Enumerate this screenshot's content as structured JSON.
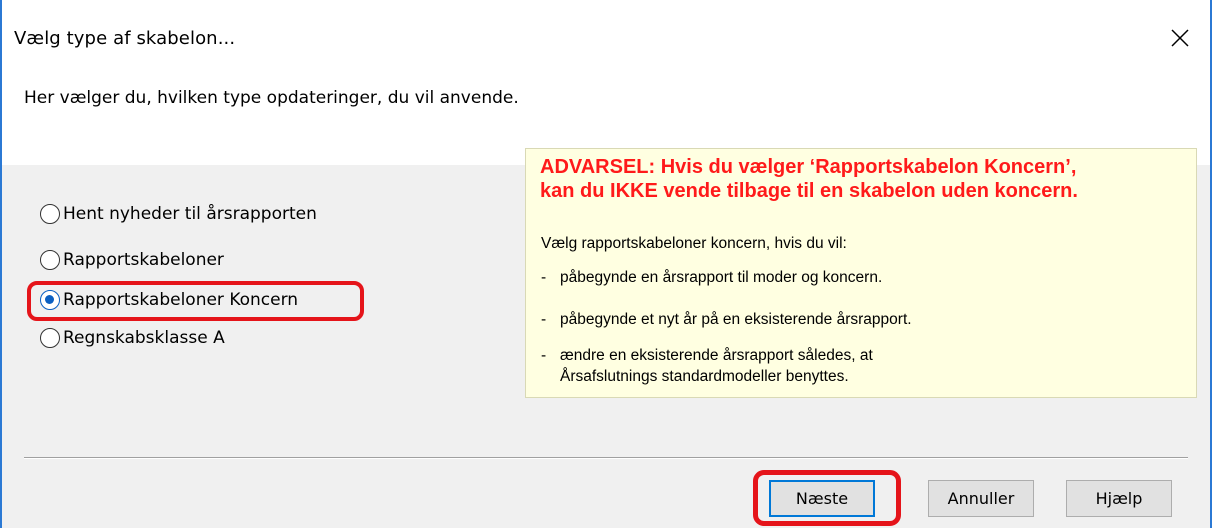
{
  "window": {
    "title": "Vælg type af skabelon...",
    "close_icon": "close-icon"
  },
  "header": {
    "subtitle": "Her vælger du, hvilken type opdateringer, du vil anvende."
  },
  "options": [
    {
      "label": "Hent nyheder til årsrapporten",
      "checked": false
    },
    {
      "label": "Rapportskabeloner",
      "checked": false
    },
    {
      "label": "Rapportskabeloner Koncern",
      "checked": true
    },
    {
      "label": "Regnskabsklasse A",
      "checked": false
    }
  ],
  "warning": {
    "heading_line1": "ADVARSEL: Hvis du vælger ‘Rapportskabelon Koncern’,",
    "heading_line2": "kan du IKKE vende tilbage til en skabelon uden koncern.",
    "intro": "Vælg rapportskabeloner koncern, hvis du vil:",
    "bullets": [
      "påbegynde en årsrapport til moder og koncern.",
      "påbegynde et nyt år på en eksisterende årsrapport.",
      "ændre en eksisterende årsrapport således, at Årsafslutnings standardmodeller benyttes."
    ],
    "bullet_marker": "-"
  },
  "buttons": {
    "next": "Næste",
    "cancel": "Annuller",
    "help": "Hjælp"
  },
  "colors": {
    "accent": "#0078d7",
    "highlight": "#e5141a",
    "warning_text": "#ff1a1a",
    "warning_bg": "#ffffe1"
  }
}
